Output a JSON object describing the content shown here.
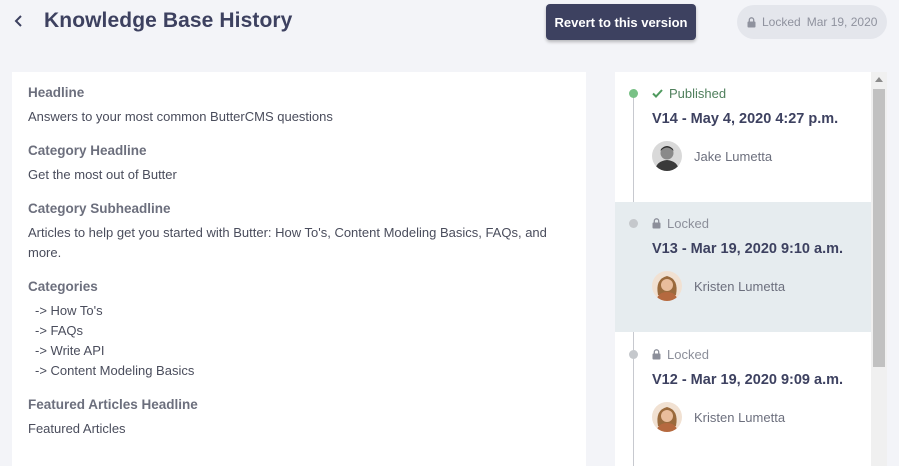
{
  "header": {
    "title": "Knowledge Base History",
    "revert_label": "Revert to this version",
    "locked_label": "Locked",
    "locked_date": "Mar 19, 2020"
  },
  "content": {
    "fields": [
      {
        "label": "Headline",
        "value": "Answers to your most common ButterCMS questions"
      },
      {
        "label": "Category Headline",
        "value": "Get the most out of Butter"
      },
      {
        "label": "Category Subheadline",
        "value": "Articles to help get you started with Butter: How To's, Content Modeling Basics, FAQs, and more."
      }
    ],
    "categories_label": "Categories",
    "categories": [
      "-> How To's",
      "-> FAQs",
      "-> Write API",
      "-> Content Modeling Basics"
    ],
    "featured_label": "Featured Articles Headline",
    "featured_value": "Featured Articles"
  },
  "history": {
    "versions": [
      {
        "status": "Published",
        "title": "V14 - May 4, 2020 4:27 p.m.",
        "author": "Jake Lumetta"
      },
      {
        "status": "Locked",
        "title": "V13 - Mar 19, 2020 9:10 a.m.",
        "author": "Kristen Lumetta"
      },
      {
        "status": "Locked",
        "title": "V12 - Mar 19, 2020 9:09 a.m.",
        "author": "Kristen Lumetta"
      }
    ]
  },
  "colors": {
    "primary": "#3d4160",
    "published": "#79c186",
    "active_row": "#e6ecef",
    "background": "#f3f4f8"
  }
}
